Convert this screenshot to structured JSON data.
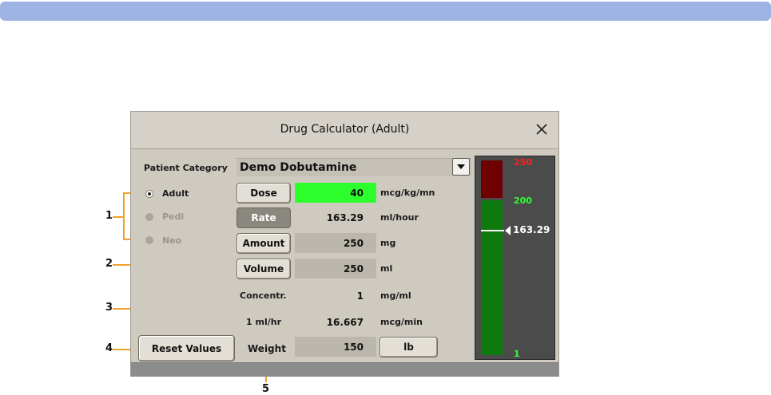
{
  "dialog": {
    "title": "Drug Calculator (Adult)"
  },
  "patient_category": {
    "label": "Patient Category",
    "options": [
      {
        "label": "Adult",
        "selected": true
      },
      {
        "label": "Pedi",
        "selected": false
      },
      {
        "label": "Neo",
        "selected": false
      }
    ]
  },
  "drug": {
    "name": "Demo Dobutamine"
  },
  "rows": {
    "dose": {
      "label": "Dose",
      "value": "40",
      "unit": "mcg/kg/mn"
    },
    "rate": {
      "label": "Rate",
      "value": "163.29",
      "unit": "ml/hour"
    },
    "amount": {
      "label": "Amount",
      "value": "250",
      "unit": "mg"
    },
    "volume": {
      "label": "Volume",
      "value": "250",
      "unit": "ml"
    },
    "concentr": {
      "label": "Concentr.",
      "value": "1",
      "unit": "mg/ml"
    },
    "mlhr": {
      "label": "1 ml/hr",
      "value": "16.667",
      "unit": "mcg/min"
    },
    "weight": {
      "label": "Weight",
      "value": "150",
      "unit_button": "lb"
    }
  },
  "buttons": {
    "reset": "Reset Values"
  },
  "gauge": {
    "max_label": "250",
    "limit_label": "200",
    "current_value": "163.29",
    "min_label": "1",
    "colors": {
      "upper_zone": "#6e0000",
      "normal_zone": "#0c7a0c",
      "max_text": "#ff2020",
      "limit_text": "#33ff33"
    }
  },
  "annotations": {
    "n1": "1",
    "n2": "2",
    "n3": "3",
    "n4": "4",
    "n5": "5"
  },
  "colors": {
    "active_field": "#2cff2c",
    "callout": "#f0a22a",
    "topbar": "#9db3e4"
  }
}
